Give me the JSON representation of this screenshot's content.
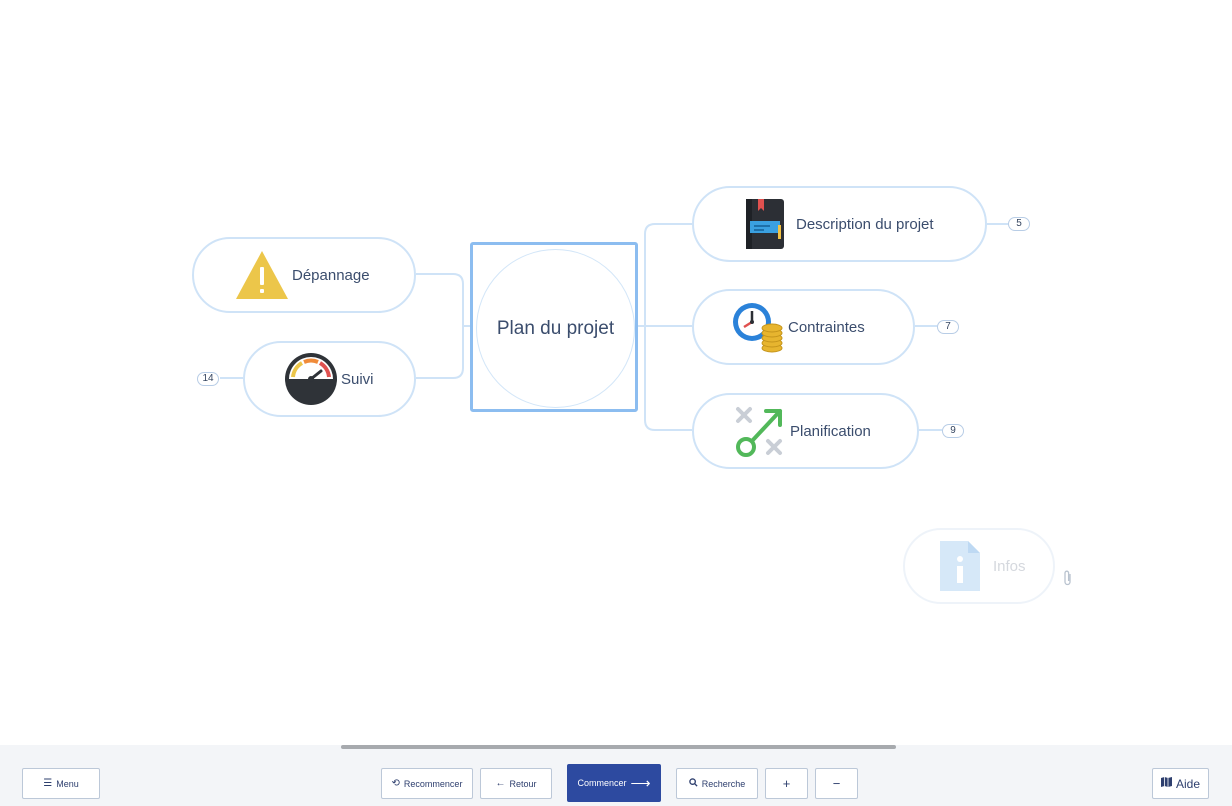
{
  "map": {
    "central": {
      "label": "Plan du projet"
    },
    "nodes": {
      "description": {
        "label": "Description du projet",
        "badge": "5",
        "icon": "notebook-icon"
      },
      "contraintes": {
        "label": "Contraintes",
        "badge": "7",
        "icon": "clock-coins-icon"
      },
      "planification": {
        "label": "Planification",
        "badge": "9",
        "icon": "strategy-arrow-icon"
      },
      "depannage": {
        "label": "Dépannage",
        "icon": "warning-triangle-icon"
      },
      "suivi": {
        "label": "Suivi",
        "badge": "14",
        "icon": "speedometer-icon"
      },
      "infos": {
        "label": "Infos",
        "icon": "info-document-icon",
        "attachment_icon": "paperclip-icon"
      }
    }
  },
  "toolbar": {
    "menu": {
      "label": "Menu",
      "icon": "hamburger-icon"
    },
    "recommencer": {
      "label": "Recommencer",
      "icon": "restart-icon"
    },
    "retour": {
      "label": "Retour",
      "icon": "arrow-left-icon"
    },
    "commencer": {
      "label": "Commencer",
      "icon": "arrow-right-icon"
    },
    "recherche": {
      "label": "Recherche",
      "icon": "search-icon"
    },
    "zoom_in": {
      "label": "+"
    },
    "zoom_out": {
      "label": "−"
    },
    "aide": {
      "label": "Aide",
      "icon": "map-icon"
    }
  },
  "colors": {
    "node_border": "#cfe3f7",
    "central_border": "#8cbdf0",
    "primary_button": "#2d4aa0",
    "toolbar_bg": "#f3f5f8"
  }
}
